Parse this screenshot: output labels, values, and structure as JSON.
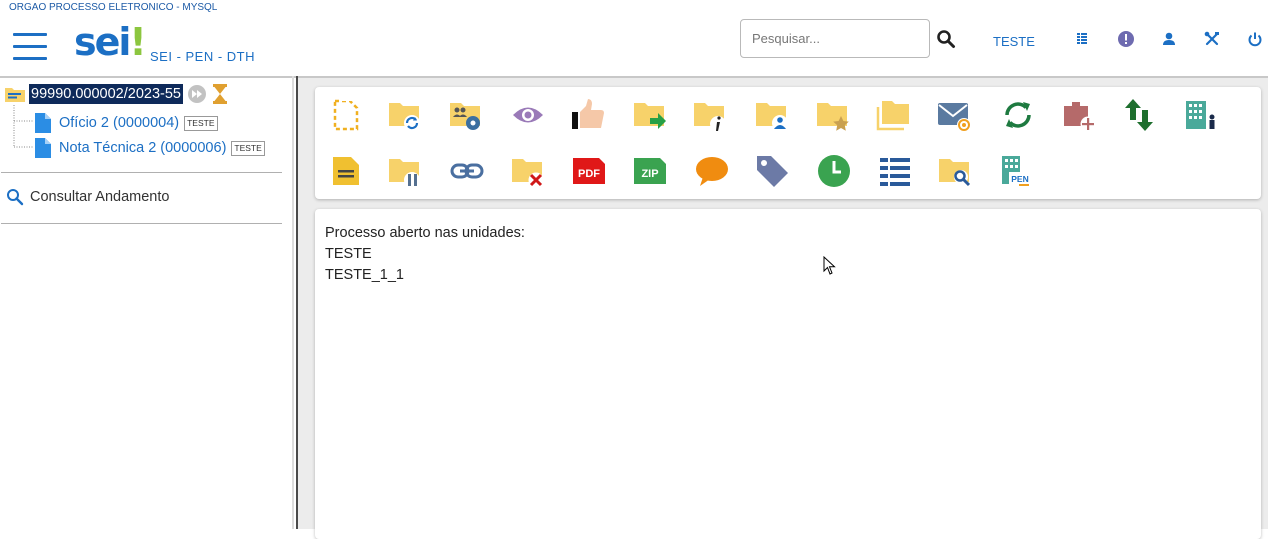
{
  "header": {
    "org_title": "ORGAO PROCESSO ELETRONICO - MYSQL",
    "logo_text": "sei",
    "logo_bang": "!",
    "subtitle": "SEI - PEN - DTH",
    "search_placeholder": "Pesquisar...",
    "unit_label": "TESTE",
    "icons": [
      "menu-icon",
      "search-icon",
      "grid-icon",
      "alert-icon",
      "user-icon",
      "tools-icon",
      "power-icon"
    ]
  },
  "tree": {
    "process_number": "99990.000002/2023-55",
    "documents": [
      {
        "label": "Ofício 2 (0000004)",
        "tag": "TESTE"
      },
      {
        "label": "Nota Técnica 2 (0000006)",
        "tag": "TESTE"
      }
    ],
    "consult_label": "Consultar Andamento"
  },
  "toolbar": {
    "row1": [
      "new-document-icon",
      "folder-reopen-icon",
      "folder-users-config-icon",
      "eye-icon",
      "thumbs-up-icon",
      "folder-send-icon",
      "folder-info-icon",
      "folder-user-icon",
      "folder-star-icon",
      "folders-icon",
      "email-icon",
      "sync-icon",
      "add-block-icon",
      "up-down-arrows-icon",
      "building-person-icon"
    ],
    "row2": [
      "note-icon",
      "folder-pause-icon",
      "link-icon",
      "folder-remove-icon",
      "pdf-icon",
      "zip-icon",
      "comment-icon",
      "tag-icon",
      "clock-icon",
      "list-icon",
      "folder-search-icon",
      "pen-building-icon"
    ],
    "pdf_text": "PDF",
    "zip_text": "ZIP",
    "pen_text": "PEN"
  },
  "content": {
    "lines": [
      "Processo aberto nas unidades:",
      "TESTE",
      "TESTE_1_1"
    ]
  },
  "colors": {
    "brand_blue": "#1c6fc4",
    "brand_green": "#8cc63f",
    "selected_bg": "#0e2a5a",
    "folder_yellow": "#f7d26a"
  }
}
